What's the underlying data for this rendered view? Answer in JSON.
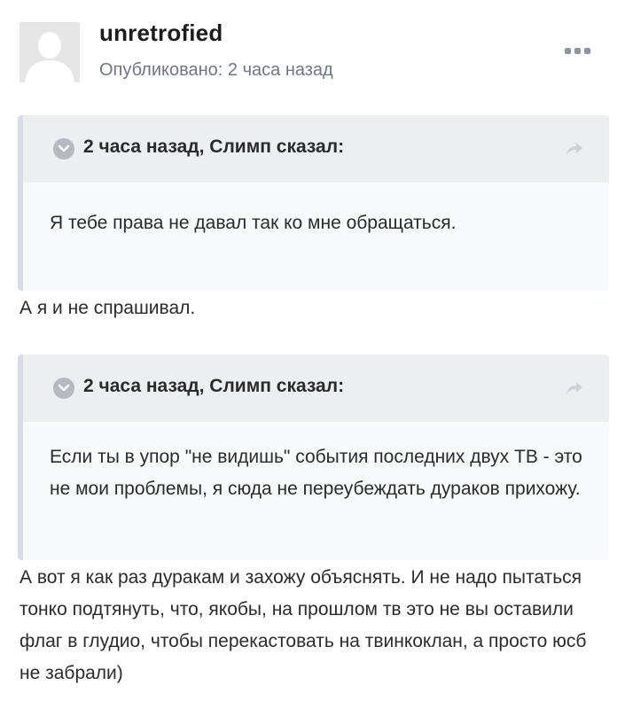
{
  "post": {
    "author": "unretrofied",
    "posted": "Опубликовано: 2 часа назад",
    "avatar_icon": "user-silhouette-icon",
    "more_icon": "more-options-icon"
  },
  "quotes": [
    {
      "title": "2 часа назад, Слимп сказал:",
      "text": "Я тебе права не давал так ко мне обращаться."
    },
    {
      "title": "2 часа назад, Слимп сказал:",
      "text": "Если ты в упор \"не видишь\" события последних двух ТВ - это не мои проблемы, я сюда не переубеждать дураков прихожу."
    }
  ],
  "replies": [
    "А я и не спрашивал.",
    "А вот я как раз дуракам и захожу объяснять. И не надо пытаться тонко подтянуть, что, якобы, на прошлом тв это не вы оставили флаг в глудио, чтобы перекастовать на твинкоклан, а просто юсб не забрали)"
  ]
}
